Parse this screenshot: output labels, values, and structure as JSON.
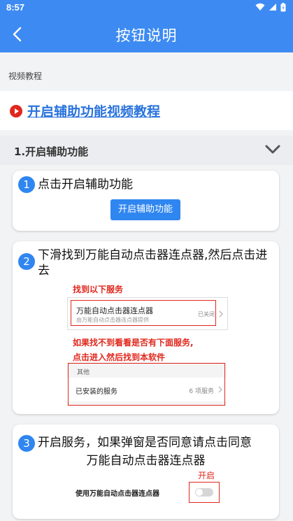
{
  "status_bar": {
    "time": "8:57"
  },
  "app_bar": {
    "title": "按钮说明"
  },
  "section_label": "视频教程",
  "video_link": {
    "text": "开启辅助功能视频教程"
  },
  "collapse": {
    "title": "1.开启辅助功能"
  },
  "step1": {
    "number": "1",
    "text": "点击开启辅助功能",
    "button": "开启辅助功能"
  },
  "step2": {
    "number": "2",
    "text": "下滑找到万能自动点击器连点器,然后点击进去",
    "hint1": "找到以下服务",
    "service_name": "万能自动点击器连点器",
    "service_sub": "由万能自动点击器连点器提供",
    "service_status": "已关闭",
    "hint2_line1": "如果找不到看看是否有下面服务,",
    "hint2_line2": "点击进入然后找到本软件",
    "other_header": "其他",
    "installed_label": "已安装的服务",
    "installed_count": "6 项服务"
  },
  "step3": {
    "number": "3",
    "text_line1": "开启服务，如果弹窗是否同意请点击同意",
    "text_line2": "万能自动点击器连点器",
    "toggle_hint": "开启",
    "toggle_label": "使用万能自动点击器连点器",
    "toggle_state": "off"
  }
}
